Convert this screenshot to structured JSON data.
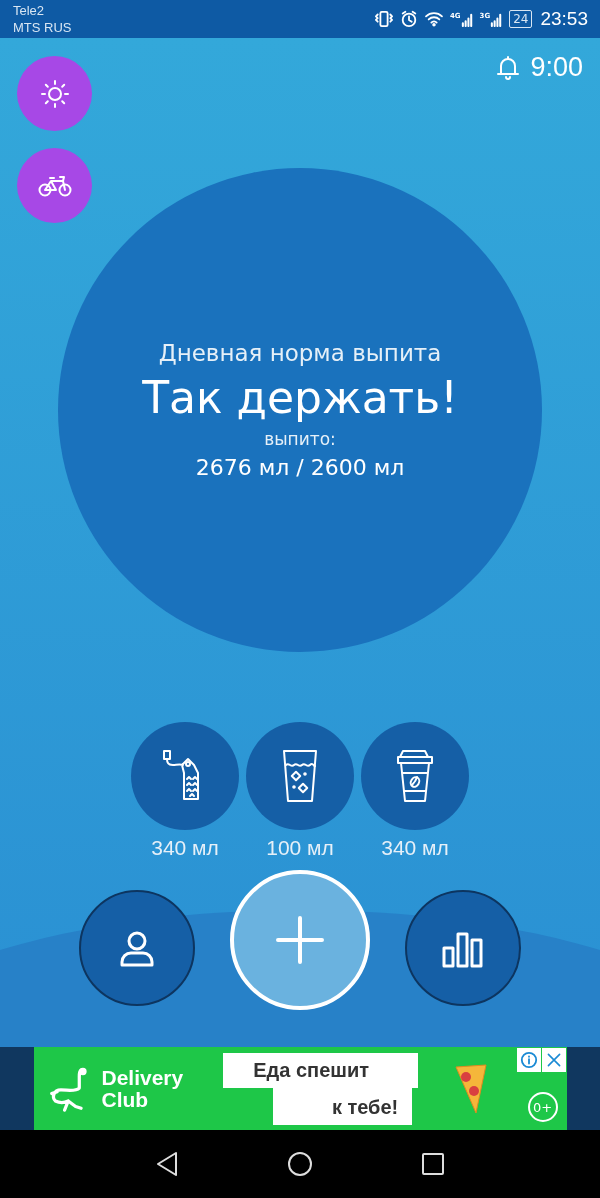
{
  "status_bar": {
    "carriers": [
      "Tele2",
      "MTS RUS"
    ],
    "networks": [
      "4G",
      "3G"
    ],
    "battery": "24",
    "time": "23:53"
  },
  "reminder": {
    "time": "9:00"
  },
  "progress": {
    "title": "Дневная норма выпита",
    "message": "Так держать!",
    "label": "выпито:",
    "amount": "2676 мл / 2600 мл"
  },
  "drinks": [
    {
      "kind": "tea",
      "amount": "340 мл"
    },
    {
      "kind": "water",
      "amount": "100 мл"
    },
    {
      "kind": "coffee",
      "amount": "340 мл"
    }
  ],
  "ad": {
    "brand_lines": [
      "Delivery",
      "Club"
    ],
    "headline_lines": [
      "Еда спешит",
      "к тебе!"
    ],
    "age_rating": "0+"
  }
}
